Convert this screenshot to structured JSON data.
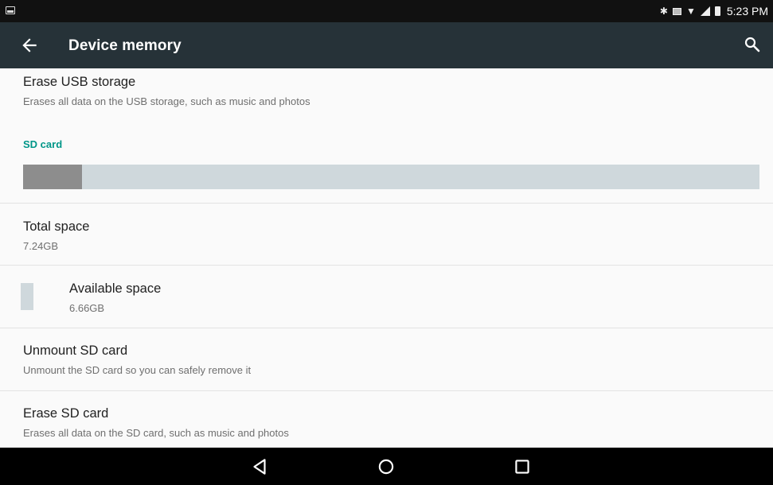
{
  "status_bar": {
    "time": "5:23 PM",
    "icons": [
      "picture-notification-icon",
      "bluetooth-icon",
      "storage-notification-icon",
      "wifi-icon",
      "cell-signal-icon",
      "battery-icon"
    ]
  },
  "app_bar": {
    "title": "Device memory",
    "back_icon": "arrow-back-icon",
    "search_icon": "search-icon",
    "color": "#263238"
  },
  "items": {
    "erase_usb": {
      "title": "Erase USB storage",
      "summary": "Erases all data on the USB storage, such as music and photos"
    },
    "sd_section": {
      "label": "SD card",
      "color": "#009688"
    },
    "storage_bar": {
      "used_fraction": 0.0801,
      "used_color": "#8d8d8d",
      "free_color": "#cfd8dc"
    },
    "total_space": {
      "title": "Total space",
      "value": "7.24GB"
    },
    "available_space": {
      "title": "Available space",
      "value": "6.66GB"
    },
    "unmount_sd": {
      "title": "Unmount SD card",
      "summary": "Unmount the SD card so you can safely remove it"
    },
    "erase_sd": {
      "title": "Erase SD card",
      "summary": "Erases all data on the SD card, such as music and photos"
    }
  },
  "nav_bar": {
    "buttons": [
      "back-triangle-icon",
      "home-circle-icon",
      "recents-square-icon"
    ]
  }
}
